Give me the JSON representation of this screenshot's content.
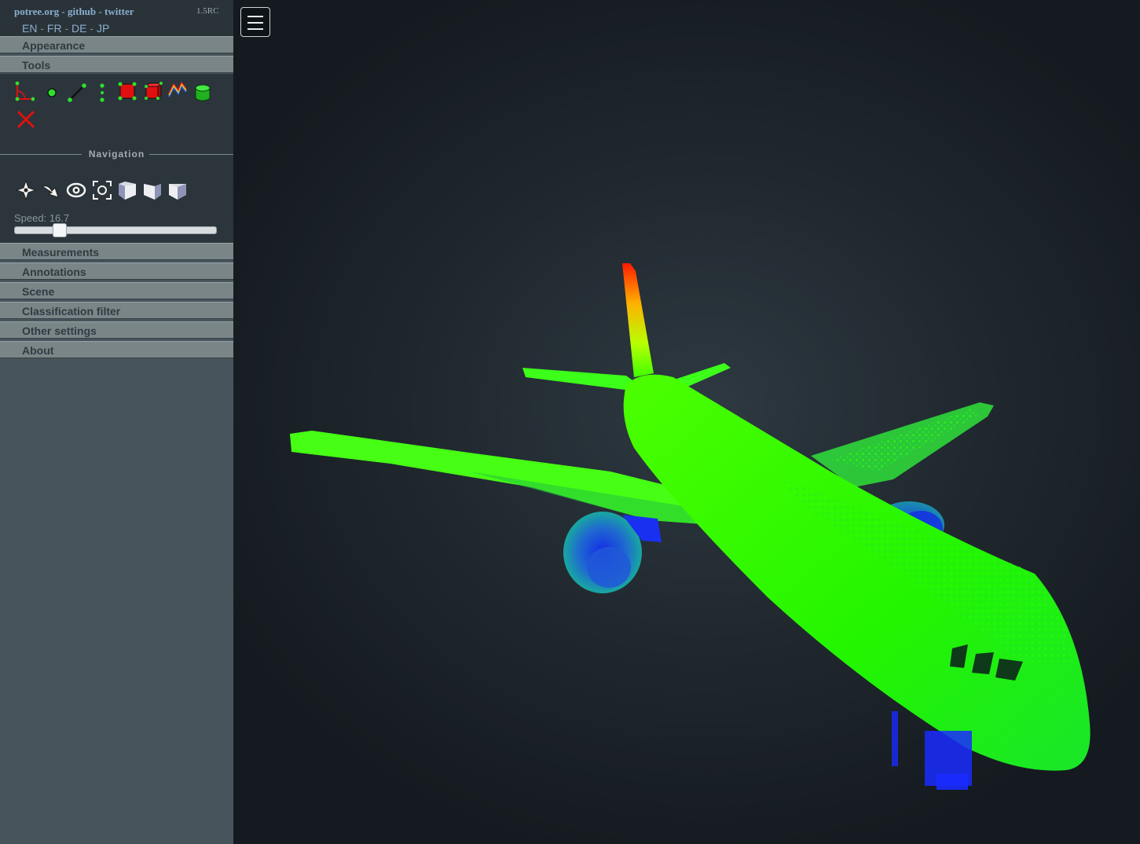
{
  "header": {
    "brand_links": [
      "potree.org",
      "github",
      "twitter"
    ],
    "separator": " - ",
    "version": "1.5RC",
    "languages": [
      "EN",
      "FR",
      "DE",
      "JP"
    ]
  },
  "sidebar": {
    "sections": {
      "appearance": "Appearance",
      "tools": "Tools",
      "measurements": "Measurements",
      "annotations": "Annotations",
      "scene": "Scene",
      "classification_filter": "Classification filter",
      "other_settings": "Other settings",
      "about": "About"
    },
    "tool_icons": [
      "angle-icon",
      "point-icon",
      "distance-icon",
      "height-icon",
      "area-icon",
      "volume-icon",
      "profile-icon",
      "cylinder-icon",
      "clear-icon"
    ],
    "navigation": {
      "title": "Navigation",
      "icons": [
        "earth-controls-icon",
        "fly-controls-icon",
        "orbit-controls-icon",
        "focus-icon",
        "left-view-icon",
        "front-view-icon",
        "top-view-icon"
      ],
      "speed_label": "Speed: 16.7",
      "speed_value": 16.7,
      "speed_fraction": 0.2
    }
  },
  "viewer": {
    "menu_icon": "hamburger-menu-icon",
    "content": "point-cloud-airplane",
    "colors": {
      "high": "#ff1a00",
      "mid": "#20ff00",
      "low": "#0a20ff"
    }
  }
}
